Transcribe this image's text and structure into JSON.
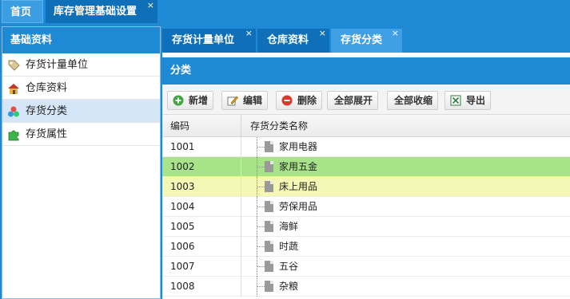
{
  "top_tabs": {
    "home": "首页",
    "active": "库存管理基础设置",
    "close": "×"
  },
  "sidebar": {
    "title": "基础资料",
    "items": [
      {
        "label": "存货计量单位",
        "icon": "tag-icon"
      },
      {
        "label": "仓库资料",
        "icon": "house-icon"
      },
      {
        "label": "存货分类",
        "icon": "colored-dots-icon"
      },
      {
        "label": "存货属性",
        "icon": "puzzle-icon"
      }
    ],
    "selected_index": 2
  },
  "sub_tabs": [
    {
      "label": "存货计量单位",
      "close": "×"
    },
    {
      "label": "仓库资料",
      "close": "×"
    },
    {
      "label": "存货分类",
      "close": "×",
      "active": true
    }
  ],
  "panel": {
    "title": "分类"
  },
  "toolbar": {
    "add": "新增",
    "edit": "编辑",
    "delete": "删除",
    "expand_all": "全部展开",
    "collapse_all": "全部收缩",
    "export": "导出"
  },
  "grid": {
    "columns": [
      "编码",
      "存货分类名称"
    ],
    "rows": [
      {
        "code": "1001",
        "name": "家用电器",
        "highlight": ""
      },
      {
        "code": "1002",
        "name": "家用五金",
        "highlight": "green"
      },
      {
        "code": "1003",
        "name": "床上用品",
        "highlight": "yellow"
      },
      {
        "code": "1004",
        "name": "劳保用品",
        "highlight": ""
      },
      {
        "code": "1005",
        "name": "海鲜",
        "highlight": ""
      },
      {
        "code": "1006",
        "name": "时蔬",
        "highlight": ""
      },
      {
        "code": "1007",
        "name": "五谷",
        "highlight": ""
      },
      {
        "code": "1008",
        "name": "杂粮",
        "highlight": ""
      }
    ]
  },
  "colors": {
    "header_blue": "#1e8ad6",
    "row_selected": "#a8e38a",
    "row_hover": "#f5f7b4"
  }
}
